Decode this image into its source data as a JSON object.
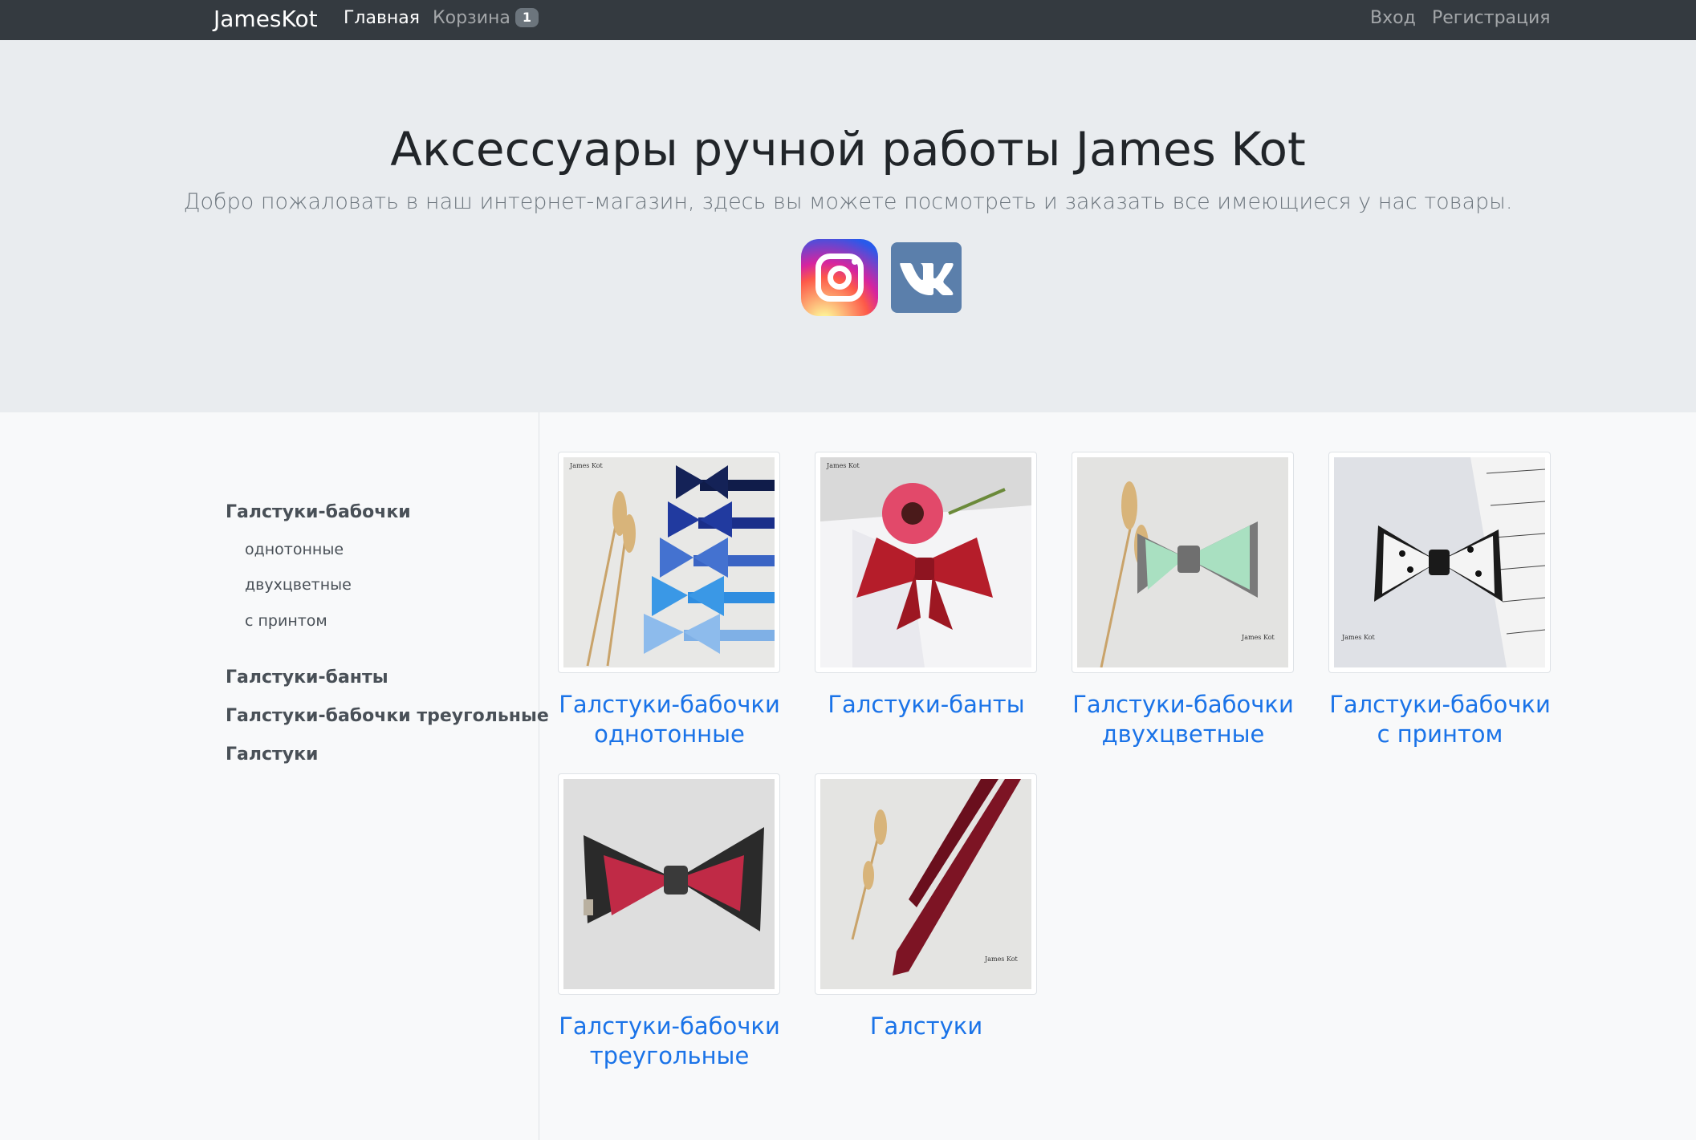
{
  "navbar": {
    "brand": "JamesKot",
    "home": "Главная",
    "cart": "Корзина",
    "cart_count": "1",
    "login": "Вход",
    "register": "Регистрация"
  },
  "hero": {
    "title": "Аксессуары ручной работы James Kot",
    "lead": "Добро пожаловать в наш интернет-магазин, здесь вы можете посмотреть и заказать все имеющиеся у нас товары.",
    "social": [
      "instagram-icon",
      "vk-icon"
    ]
  },
  "sidebar": {
    "categories": [
      {
        "label": "Галстуки-бабочки",
        "subs": [
          "однотонные",
          "двухцветные",
          "с принтом"
        ]
      },
      {
        "label": "Галстуки-банты"
      },
      {
        "label": "Галстуки-бабочки треугольные"
      },
      {
        "label": "Галстуки"
      }
    ]
  },
  "products": [
    {
      "line1": "Галстуки-бабочки",
      "line2": "однотонные"
    },
    {
      "line1": "Галстуки-банты",
      "line2": ""
    },
    {
      "line1": "Галстуки-бабочки",
      "line2": "двухцветные"
    },
    {
      "line1": "Галстуки-бабочки",
      "line2": "с принтом"
    },
    {
      "line1": "Галстуки-бабочки",
      "line2": "треугольные"
    },
    {
      "line1": "Галстуки",
      "line2": ""
    }
  ],
  "watermark": "James Kot",
  "colors": {
    "navbar": "#343a40",
    "jumbotron": "#e9ecef",
    "link": "#1a73e8",
    "badge": "#6c757d"
  }
}
